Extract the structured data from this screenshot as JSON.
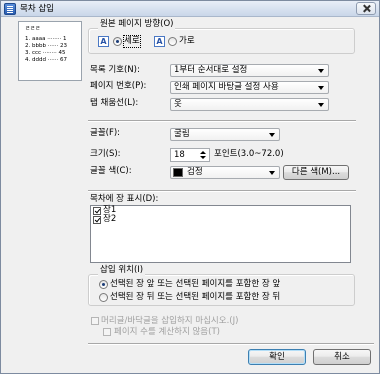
{
  "window": {
    "title": "목차 삽입",
    "title_icon": "document-icon"
  },
  "preview": {
    "heading": "ㄹㄹㄹ",
    "lines": [
      "1. aaaa ········ 1",
      "2. bbbb ······ 23",
      "3. ccc ········ 45",
      "4. dddd ······ 67"
    ]
  },
  "orientation": {
    "legend": "원본 페이지 방향(O)",
    "icon_letter": "A",
    "options": [
      {
        "label": "세로",
        "selected": true
      },
      {
        "label": "가로",
        "selected": false
      }
    ]
  },
  "fields": {
    "list_symbol": {
      "label": "목록 기호(N):",
      "value": "1부터 순서대로 설정"
    },
    "page_number": {
      "label": "페이지 번호(P):",
      "value": "인쇄 페이지 바탕글 설정 사용"
    },
    "tab_leader": {
      "label": "탭 채움선(L):",
      "value": "옷"
    },
    "font": {
      "label": "글꼴(F):",
      "value": "굴림"
    },
    "size": {
      "label": "크기(S):",
      "value": "18",
      "unit_hint": "포인트(3.0~72.0)"
    },
    "color": {
      "label": "글꼴 색(C):",
      "value": "검정",
      "swatch": "#000000",
      "more_button": "다른 색(M)..."
    }
  },
  "chapters": {
    "label": "목차에 장 표시(D):",
    "items": [
      {
        "label": "장1",
        "checked": true
      },
      {
        "label": "장2",
        "checked": true
      }
    ]
  },
  "insert_position": {
    "legend": "삽입 위치(I)",
    "options": [
      {
        "label": "선택된 장 앞 또는 선택된 페이지를 포함한 장 앞",
        "selected": true
      },
      {
        "label": "선택된 장 뒤 또는 선택된 페이지를 포함한 장 뒤",
        "selected": false
      }
    ]
  },
  "options": {
    "no_header_footer": {
      "label": "머리글/바닥글을 삽입하지 마십시오.(J)",
      "checked": false,
      "disabled": true
    },
    "no_page_count": {
      "label": "페이지 수를 계산하지 않음(T)",
      "checked": false,
      "disabled": true
    }
  },
  "buttons": {
    "ok": "확인",
    "cancel": "취소"
  },
  "colors": {
    "window_bg": "#f0f0f0",
    "title_bar": "#d3deee",
    "accent": "#2f63b6",
    "disabled_text": "#a0a0a0"
  }
}
